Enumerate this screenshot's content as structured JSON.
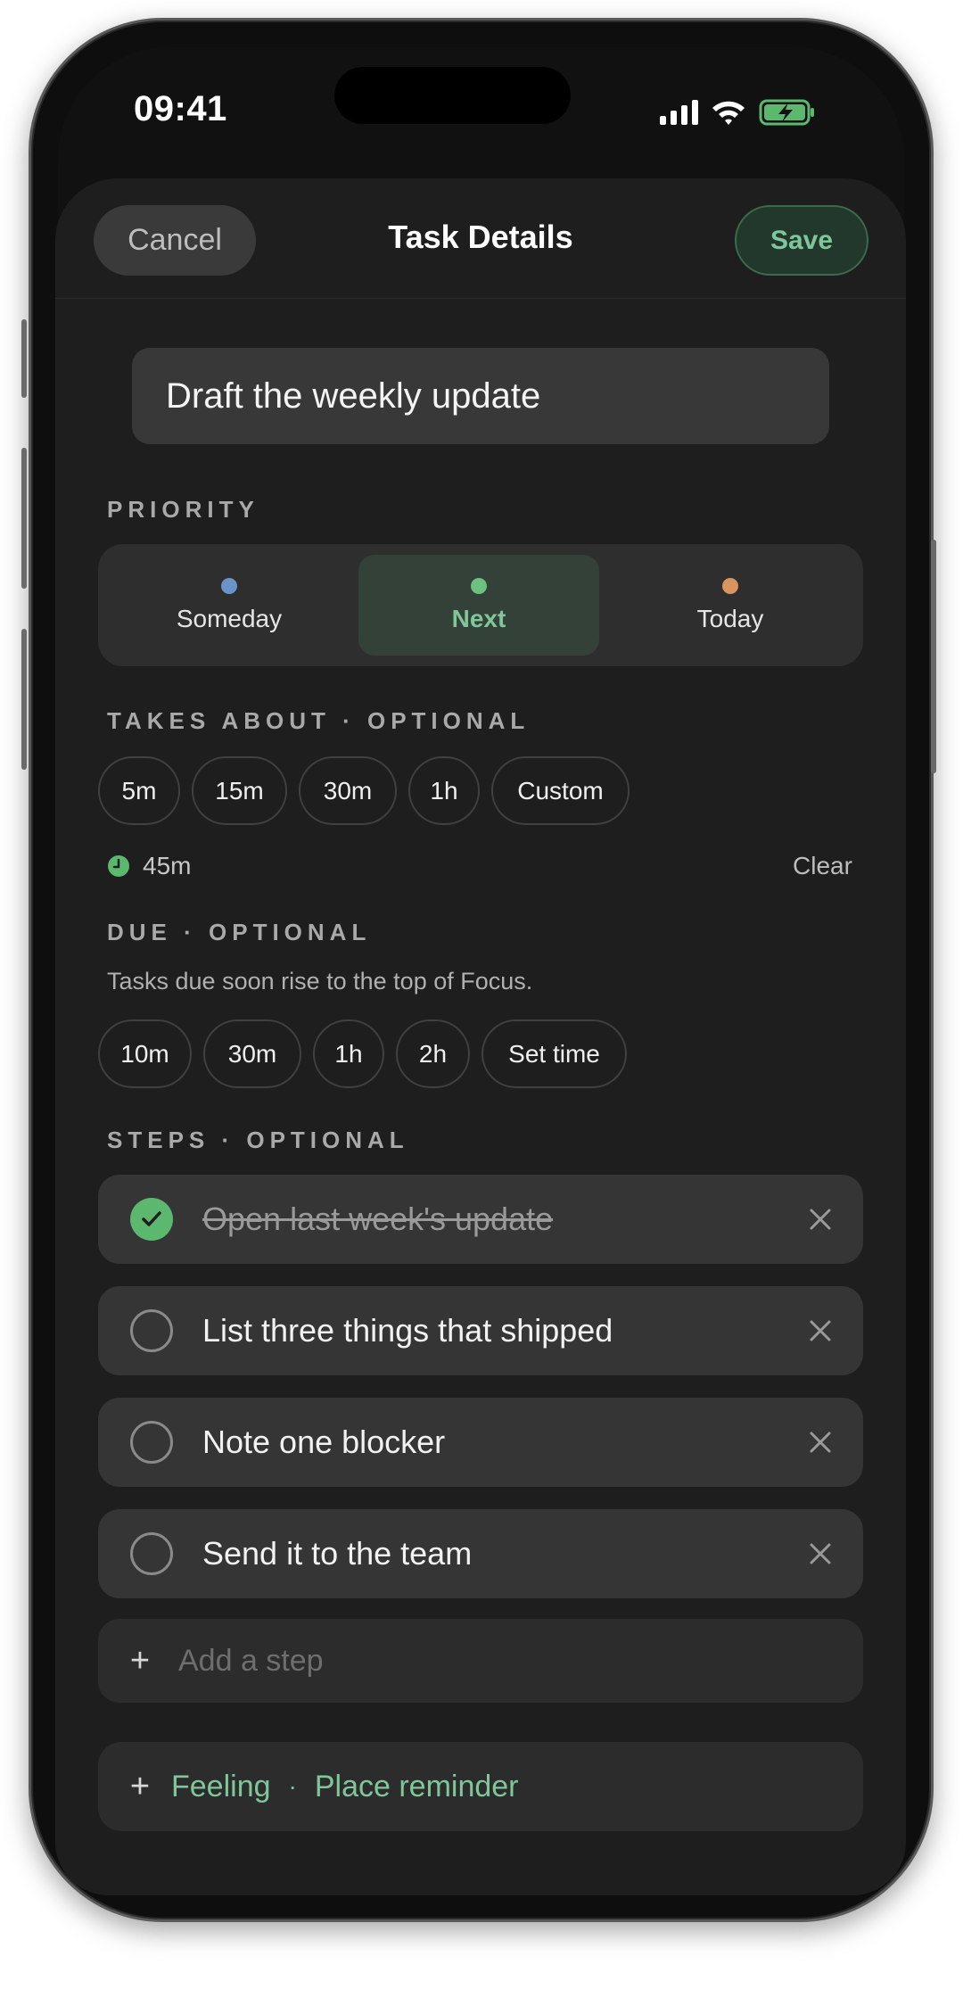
{
  "status_bar": {
    "time": "09:41",
    "icons": [
      "cellular-signal-icon",
      "wifi-icon",
      "battery-charging-icon"
    ]
  },
  "nav": {
    "cancel_label": "Cancel",
    "title": "Task Details",
    "save_label": "Save"
  },
  "task": {
    "title": "Draft the weekly update"
  },
  "priority": {
    "label": "PRIORITY",
    "selected": "Next",
    "options": [
      {
        "label": "Someday",
        "dot_color": "#6a93c9"
      },
      {
        "label": "Next",
        "dot_color": "#6cc080"
      },
      {
        "label": "Today",
        "dot_color": "#d9955f"
      }
    ]
  },
  "duration": {
    "label": "TAKES ABOUT · OPTIONAL",
    "chips": [
      "5m",
      "15m",
      "30m",
      "1h",
      "Custom"
    ],
    "current_value": "45m",
    "clear_label": "Clear"
  },
  "due": {
    "label": "DUE · OPTIONAL",
    "hint": "Tasks due soon rise to the top of Focus.",
    "chips": [
      "10m",
      "30m",
      "1h",
      "2h",
      "Set time"
    ]
  },
  "steps": {
    "label": "STEPS · OPTIONAL",
    "items": [
      {
        "text": "Open last week's update",
        "done": true
      },
      {
        "text": "List three things that shipped",
        "done": false
      },
      {
        "text": "Note one blocker",
        "done": false
      },
      {
        "text": "Send it to the team",
        "done": false
      }
    ],
    "add_placeholder": "Add a step"
  },
  "extras": {
    "feeling_label": "Feeling",
    "separator": "·",
    "place_reminder_label": "Place reminder"
  },
  "colors": {
    "accent": "#7fc79a",
    "background": "#1e1e1e",
    "check_done": "#5cb86f"
  }
}
